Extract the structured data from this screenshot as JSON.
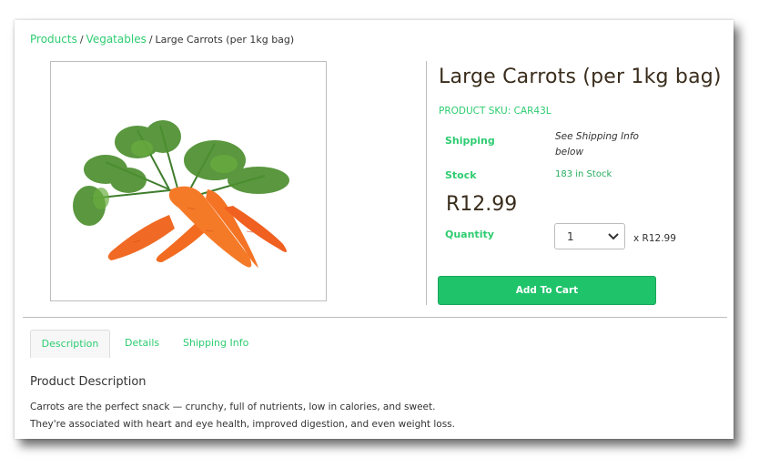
{
  "breadcrumb": {
    "items": [
      "Products",
      "Vegatables"
    ],
    "separator": "/",
    "current": "Large Carrots (per 1kg bag)"
  },
  "product": {
    "image_alt": "carrots-product-image",
    "title": "Large Carrots (per 1kg bag)",
    "sku": "PRODUCT SKU: CAR43L",
    "shipping_label": "Shipping",
    "shipping_value": "See Shipping Info below",
    "stock_label": "Stock",
    "stock_value": "183 in Stock",
    "price": "R12.99",
    "quantity_label": "Quantity",
    "quantity_value": "1",
    "quantity_multiplier": "x R12.99",
    "add_to_cart": "Add To Cart"
  },
  "tabs": [
    {
      "label": "Description",
      "active": true
    },
    {
      "label": "Details",
      "active": false
    },
    {
      "label": "Shipping Info",
      "active": false
    }
  ],
  "description": {
    "heading": "Product Description",
    "lines": [
      "Carrots are the perfect snack — crunchy, full of nutrients, low in calories, and sweet.",
      "They're associated with heart and eye health, improved digestion, and even weight loss."
    ]
  },
  "colors": {
    "accent": "#2ecc71",
    "button": "#1fc36a",
    "title": "#3a2d1c"
  },
  "icons": {
    "select_arrow": "chevron-down-icon"
  }
}
